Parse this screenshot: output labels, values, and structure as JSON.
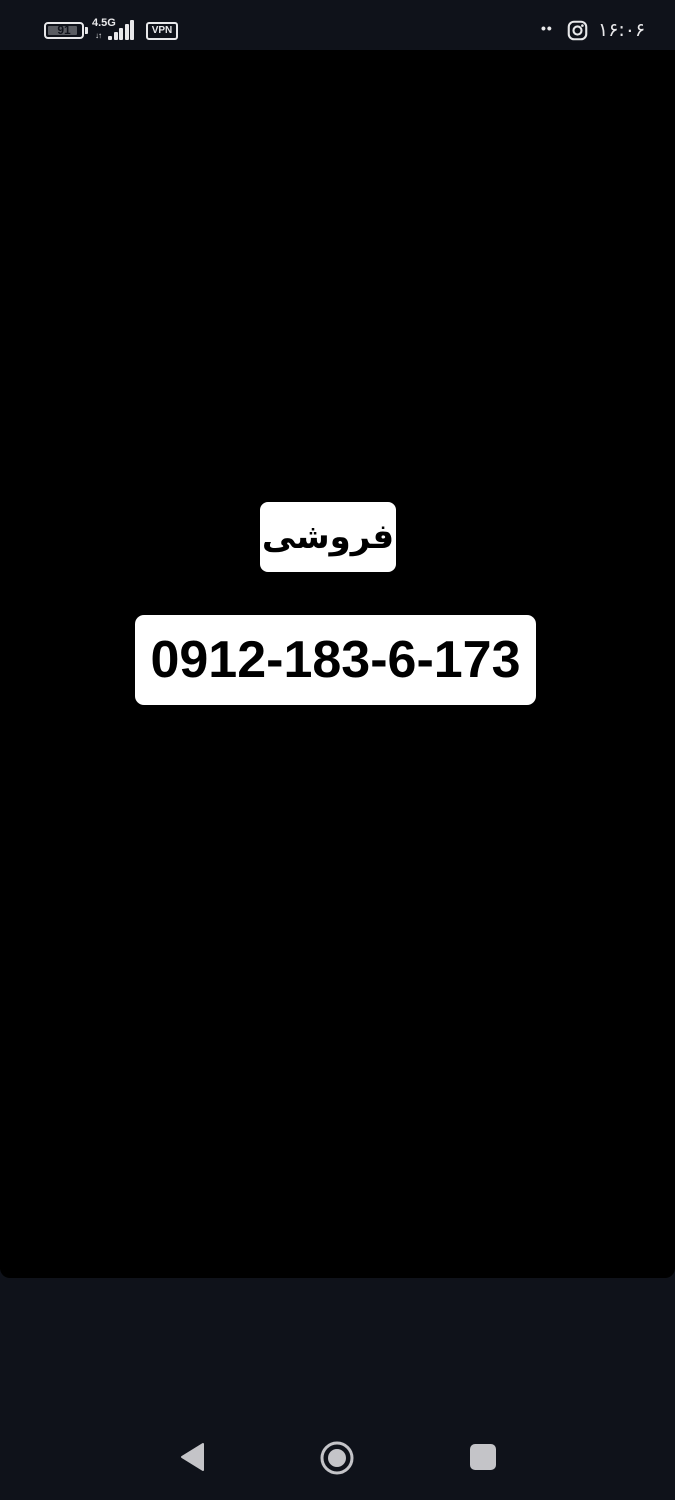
{
  "status_bar": {
    "battery_level": "91",
    "battery_fraction": 0.91,
    "network_type": "4.5G",
    "data_arrows": "↓↑",
    "signal_bars": 5,
    "vpn_label": "VPN",
    "notification_dots": "••",
    "clock": "۱۶:۰۶",
    "notification_icon": "instagram-icon"
  },
  "story": {
    "label": "فروشی",
    "phone_number": "0912-183-6-173"
  },
  "nav_bar": {
    "back_icon": "back-triangle-icon",
    "home_icon": "home-circle-icon",
    "recents_icon": "recents-square-icon"
  },
  "colors": {
    "status_bg": "#0f121a",
    "story_bg": "#000000",
    "box_bg": "#ffffff",
    "text_dark": "#000000",
    "nav_icon": "#c4c4c8"
  }
}
